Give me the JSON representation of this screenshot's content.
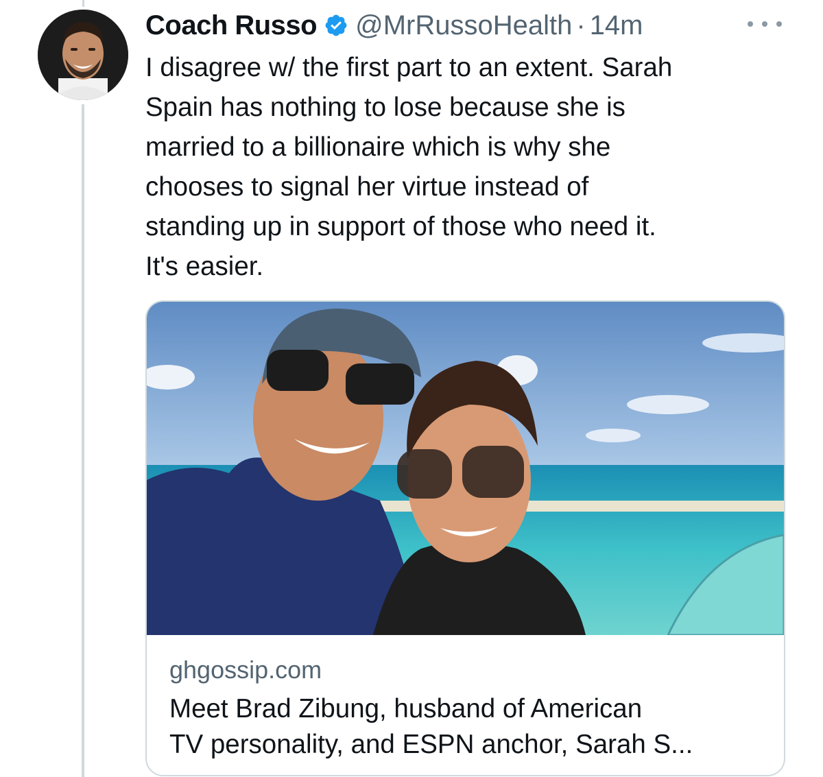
{
  "tweet": {
    "author": {
      "display_name": "Coach Russo",
      "handle": "@MrRussoHealth",
      "verified": true,
      "avatar_icon": "avatar-photo"
    },
    "separator": "·",
    "time": "14m",
    "more_icon": "more-horizontal-icon",
    "text": "I disagree w/ the first part to an extent. Sarah\nSpain has nothing to lose because she is\nmarried to a billionaire which is why she\nchooses to signal her virtue instead of\nstanding up in support of those who need it.\nIt's easier.",
    "card": {
      "domain": "ghgossip.com",
      "title": "Meet Brad Zibung, husband of American\nTV personality, and ESPN anchor, Sarah S..."
    }
  },
  "colors": {
    "text": "#0f1419",
    "secondary": "#536471",
    "verified_badge": "#1d9bf0",
    "border": "#cfd9de"
  }
}
